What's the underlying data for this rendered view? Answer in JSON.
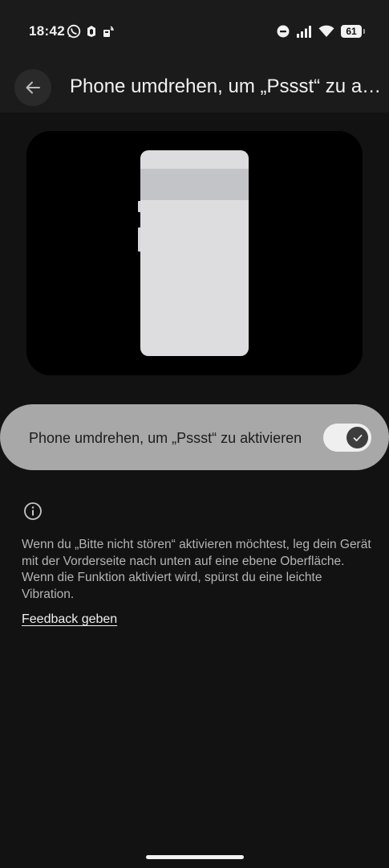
{
  "status_bar": {
    "time": "18:42",
    "battery": "61",
    "left_icons": [
      "whatsapp-icon",
      "notification-app-icon",
      "cast-app-icon"
    ],
    "right_icons": [
      "do-not-disturb-icon",
      "signal-icon",
      "wifi-icon",
      "battery-icon"
    ]
  },
  "app_bar": {
    "back_icon": "arrow-left-icon",
    "title": "Phone umdrehen, um „Pssst“ zu aktivieren"
  },
  "illustration": {
    "description_icon": "phone-illustration"
  },
  "setting": {
    "label": "Phone umdrehen, um „Pssst“ zu aktivieren",
    "enabled": true
  },
  "info": {
    "icon": "info-icon",
    "text": "Wenn du „Bitte nicht stören“ aktivieren möchtest, leg dein Gerät mit der Vorderseite nach unten auf eine ebene Oberfläche. Wenn die Funktion aktiviert wird, spürst du eine leichte Vibration.",
    "feedback_link": "Feedback geben"
  },
  "colors": {
    "background": "#121212",
    "app_bar": "#1b1b1b",
    "toggle_row": "#a8a8a8",
    "switch_track": "#efefef",
    "switch_thumb": "#3d3d3d"
  }
}
